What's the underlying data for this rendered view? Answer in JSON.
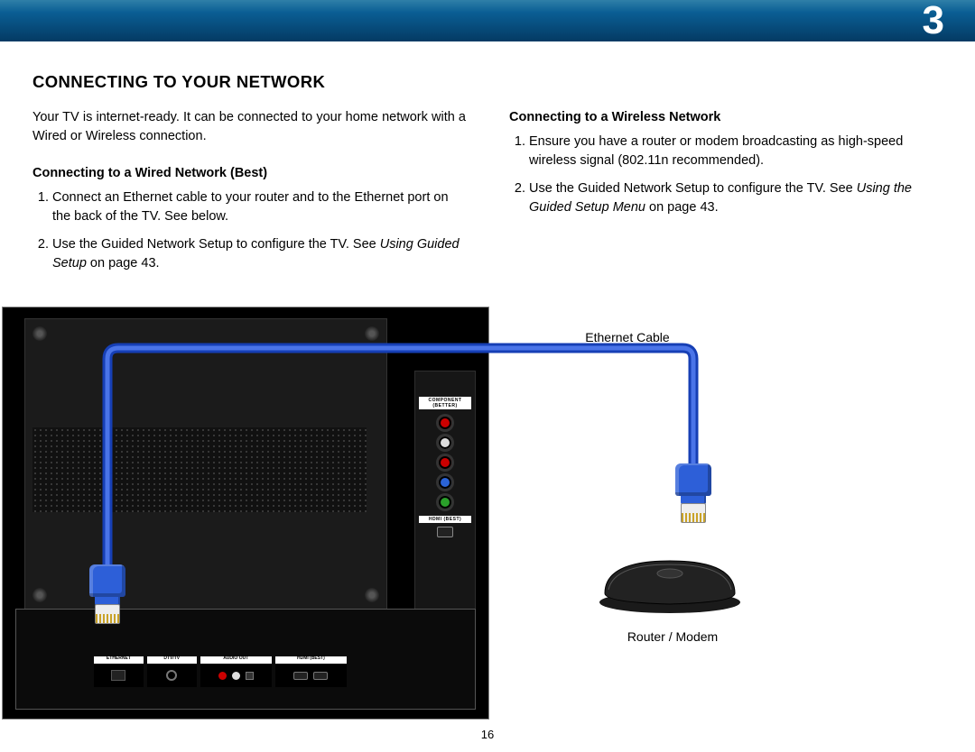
{
  "chapter_number": "3",
  "section_title": "CONNECTING TO YOUR NETWORK",
  "intro": "Your TV is internet-ready. It can be connected to your home network with a Wired or Wireless connection.",
  "wired": {
    "heading": "Connecting to a Wired Network (Best)",
    "step1": "Connect an Ethernet cable to your router and to the Ethernet port on the back of the TV. See below.",
    "step2_a": "Use the Guided Network Setup to configure the TV. See ",
    "step2_ref": "Using Guided Setup",
    "step2_b": " on page 43."
  },
  "wireless": {
    "heading": "Connecting to a Wireless Network",
    "step1": "Ensure you have a router or modem broadcasting as high-speed wireless signal (802.11n recommended).",
    "step2_a": "Use the Guided Network Setup to configure the TV. See ",
    "step2_ref": "Using the Guided Setup Menu",
    "step2_b": " on page 43."
  },
  "diagram_labels": {
    "ethernet_cable": "Ethernet Cable",
    "router_modem": "Router / Modem"
  },
  "tv_ports": {
    "component_label": "COMPONENT (BETTER)",
    "hdmi_side_label": "HDMI (BEST)",
    "ethernet": "ETHERNET",
    "dtv": "DTV/TV",
    "audio_out": "AUDIO OUT",
    "hdmi_bottom": "HDMI (BEST)"
  },
  "page_number": "16"
}
